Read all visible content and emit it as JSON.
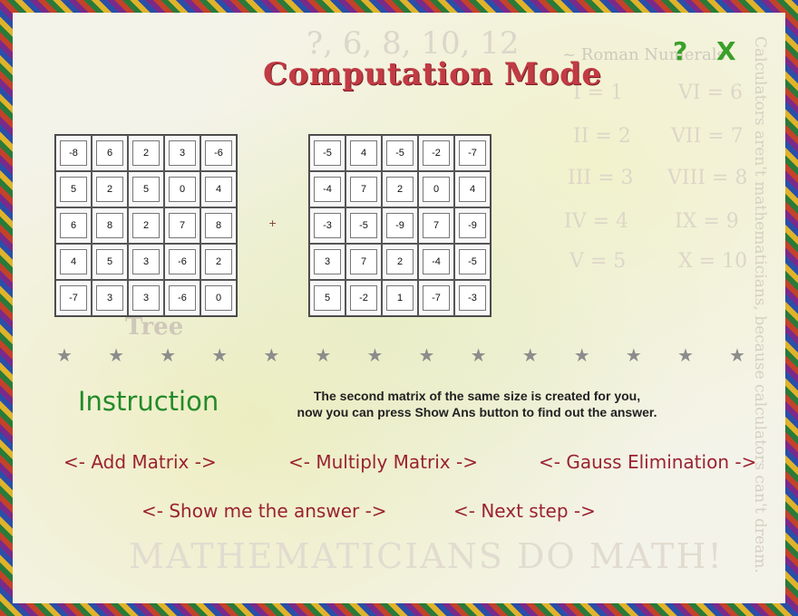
{
  "header": {
    "title": "Computation Mode",
    "help_label": "?",
    "close_label": "X"
  },
  "background": {
    "sequence": "?, 6, 8, 10, 12",
    "roman_title": "~ Roman Numerals",
    "roman": [
      {
        "numeral": "I = 1",
        "x": 0
      },
      {
        "numeral": "II = 2"
      },
      {
        "numeral": "III = 3"
      },
      {
        "numeral": "IV = 4"
      },
      {
        "numeral": "V = 5"
      },
      {
        "numeral": "VI = 6"
      },
      {
        "numeral": "VII = 7"
      },
      {
        "numeral": "VIII = 8"
      },
      {
        "numeral": "IX = 9"
      },
      {
        "numeral": "X = 10"
      }
    ],
    "vertical_text": "Calculators aren't mathematicians, because calculators can't dream.",
    "bottom_text": "MATHEMATICIANS DO MATH!",
    "tree_word": "Tree"
  },
  "matrix_a": [
    [
      "-8",
      "6",
      "2",
      "3",
      "-6"
    ],
    [
      "5",
      "2",
      "5",
      "0",
      "4"
    ],
    [
      "6",
      "8",
      "2",
      "7",
      "8"
    ],
    [
      "4",
      "5",
      "3",
      "-6",
      "2"
    ],
    [
      "-7",
      "3",
      "3",
      "-6",
      "0"
    ]
  ],
  "matrix_b": [
    [
      "-5",
      "4",
      "-5",
      "-2",
      "-7"
    ],
    [
      "-4",
      "7",
      "2",
      "0",
      "4"
    ],
    [
      "-3",
      "-5",
      "-9",
      "7",
      "-9"
    ],
    [
      "3",
      "7",
      "2",
      "-4",
      "-5"
    ],
    [
      "5",
      "-2",
      "1",
      "-7",
      "-3"
    ]
  ],
  "operator": "+",
  "instruction": {
    "heading": "Instruction",
    "line1": "The second matrix of the same size is created for you,",
    "line2": "now you can press Show Ans button to find out the answer."
  },
  "actions": {
    "add_matrix": "<- Add Matrix ->",
    "multiply_matrix": "<- Multiply Matrix ->",
    "gauss": "<- Gauss Elimination ->",
    "show_answer": "<- Show me the answer ->",
    "next_step": "<- Next step ->"
  },
  "colors": {
    "title": "#c23b44",
    "instruction": "#238a2a",
    "links": "#9a2230",
    "icons": "#3aa02a"
  }
}
